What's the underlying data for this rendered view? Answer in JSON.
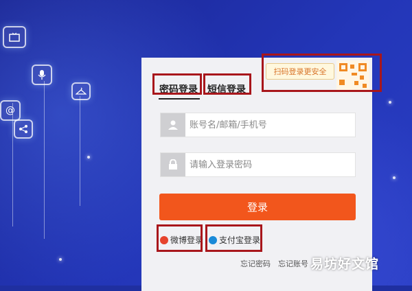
{
  "tabs": {
    "password_login": "密码登录",
    "sms_login": "短信登录"
  },
  "qr": {
    "tip": "扫码登录更安全"
  },
  "form": {
    "username_placeholder": "账号名/邮箱/手机号",
    "password_placeholder": "请输入登录密码",
    "login_button": "登录"
  },
  "social": {
    "weibo": "微博登录",
    "alipay": "支付宝登录"
  },
  "footer": {
    "forgot_password": "忘记密码",
    "forgot_account": "忘记账号"
  },
  "watermark": "易坊好文馆",
  "colors": {
    "accent": "#f2561c",
    "highlight": "#a8161b",
    "background": "#1f2fa0"
  }
}
